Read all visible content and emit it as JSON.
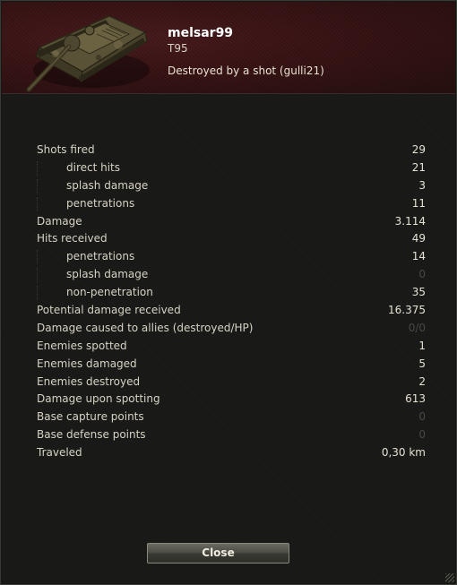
{
  "header": {
    "player_name": "melsar99",
    "tank_name": "T95",
    "death_reason": "Destroyed by a shot (gulli21)"
  },
  "stats": [
    {
      "label": "Shots fired",
      "value": "29",
      "sub": false,
      "dim": false
    },
    {
      "label": "direct hits",
      "value": "21",
      "sub": true,
      "dim": false
    },
    {
      "label": "splash damage",
      "value": "3",
      "sub": true,
      "dim": false
    },
    {
      "label": "penetrations",
      "value": "11",
      "sub": true,
      "dim": false
    },
    {
      "label": "Damage",
      "value": "3.114",
      "sub": false,
      "dim": false
    },
    {
      "label": "Hits received",
      "value": "49",
      "sub": false,
      "dim": false
    },
    {
      "label": "penetrations",
      "value": "14",
      "sub": true,
      "dim": false
    },
    {
      "label": "splash damage",
      "value": "0",
      "sub": true,
      "dim": true
    },
    {
      "label": "non-penetration",
      "value": "35",
      "sub": true,
      "dim": false
    },
    {
      "label": "Potential damage received",
      "value": "16.375",
      "sub": false,
      "dim": false
    },
    {
      "label": "Damage caused to allies (destroyed/HP)",
      "value": "0/0",
      "sub": false,
      "dim": true
    },
    {
      "label": "Enemies spotted",
      "value": "1",
      "sub": false,
      "dim": false
    },
    {
      "label": "Enemies damaged",
      "value": "5",
      "sub": false,
      "dim": false
    },
    {
      "label": "Enemies destroyed",
      "value": "2",
      "sub": false,
      "dim": false
    },
    {
      "label": "Damage upon spotting",
      "value": "613",
      "sub": false,
      "dim": false
    },
    {
      "label": "Base capture points",
      "value": "0",
      "sub": false,
      "dim": true
    },
    {
      "label": "Base defense points",
      "value": "0",
      "sub": false,
      "dim": true
    },
    {
      "label": "Traveled",
      "value": "0,30 km",
      "sub": false,
      "dim": false
    }
  ],
  "buttons": {
    "close_label": "Close"
  },
  "icons": {
    "tank": "tank-icon"
  }
}
